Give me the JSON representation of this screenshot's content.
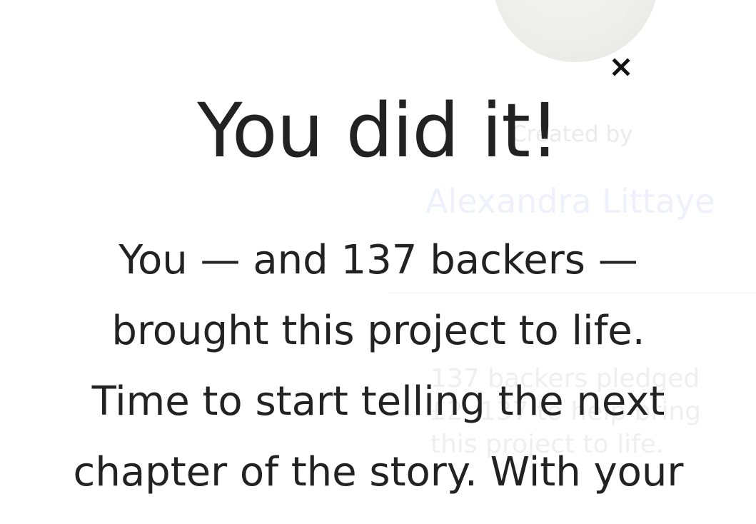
{
  "background": {
    "created_by_label": "Created by",
    "creator_name": "Alexandra Littaye",
    "stats_lines": [
      "137 backers pledged",
      "£2 ,137 to help bring",
      "this project to life."
    ]
  },
  "modal": {
    "close_icon": "close-icon",
    "title": "You did it!",
    "body_lines": [
      "You — and 137 backers —",
      "brought this project to life.",
      "Time to start telling the next",
      "chapter of the story. With your"
    ]
  },
  "colors": {
    "text": "#222222",
    "background": "#ffffff",
    "creator_link_faded": "#eef0fb"
  }
}
